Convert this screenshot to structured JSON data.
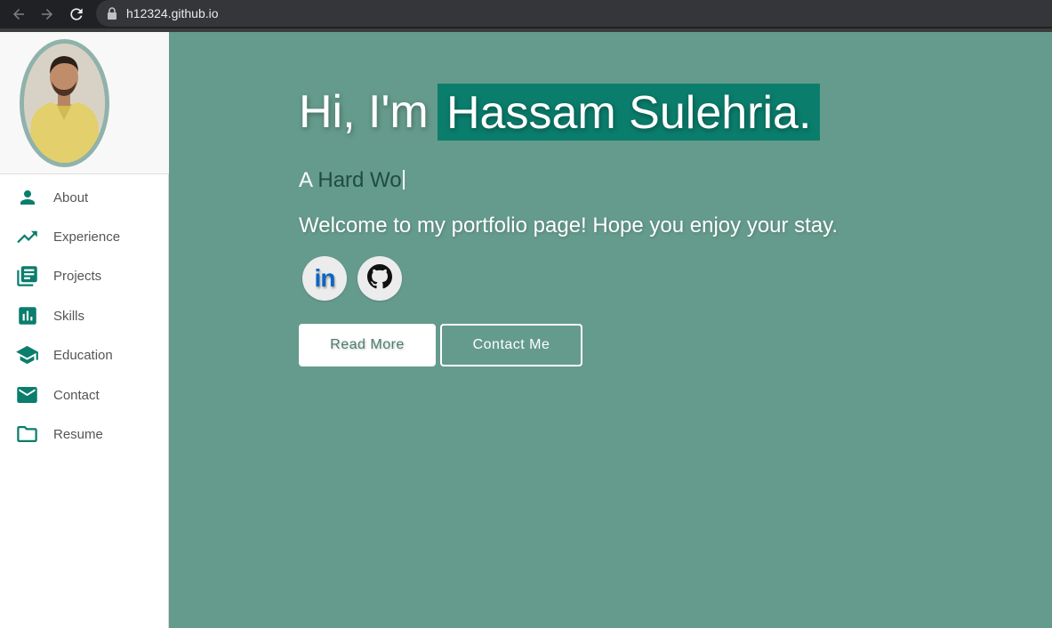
{
  "browser": {
    "url": "h12324.github.io"
  },
  "sidebar": {
    "items": [
      {
        "label": "About",
        "icon": "person-icon"
      },
      {
        "label": "Experience",
        "icon": "trending-up-icon"
      },
      {
        "label": "Projects",
        "icon": "library-books-icon"
      },
      {
        "label": "Skills",
        "icon": "bar-chart-icon"
      },
      {
        "label": "Education",
        "icon": "graduation-cap-icon"
      },
      {
        "label": "Contact",
        "icon": "mail-icon"
      },
      {
        "label": "Resume",
        "icon": "folder-icon"
      }
    ],
    "icon_color": "#0b7d6c"
  },
  "hero": {
    "greeting": "Hi, I'm ",
    "name": "Hassam Sulehria.",
    "typed_prefix": "A ",
    "typed_text": "Hard Wo",
    "welcome": "Welcome to my portfolio page! Hope you enjoy your stay.",
    "social": [
      {
        "text": "in",
        "icon": "linkedin-icon"
      },
      {
        "icon": "github-icon"
      }
    ],
    "buttons": {
      "read_more": "Read More",
      "contact_me": "Contact Me"
    },
    "background_color": "#659b8c",
    "highlight_color": "#0b7d6c"
  }
}
